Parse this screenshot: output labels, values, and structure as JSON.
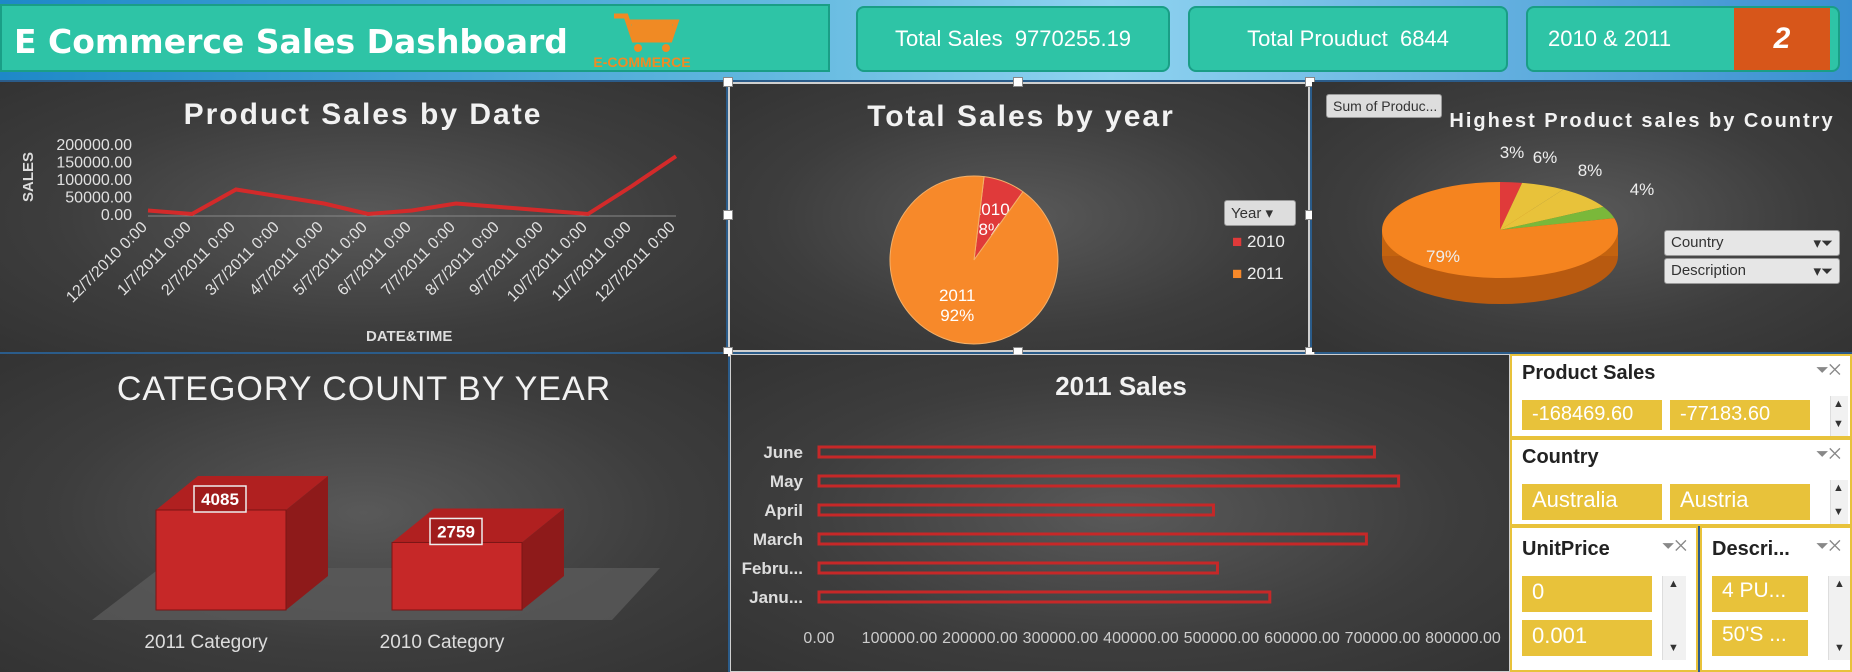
{
  "header": {
    "title": "E Commerce Sales Dashboard",
    "logo_text": "E-COMMERCE",
    "kpis": [
      {
        "label": "Total Sales",
        "value": "9770255.19"
      },
      {
        "label": "Total Prouduct",
        "value": "6844"
      },
      {
        "label": "2010 & 2011",
        "value": ""
      }
    ],
    "year_badge": "2"
  },
  "chart_data": [
    {
      "type": "line",
      "title": "Product Sales by Date",
      "xlabel": "DATE&TIME",
      "ylabel": "SALES",
      "yticks": [
        "200000.00",
        "150000.00",
        "100000.00",
        "50000.00",
        "0.00"
      ],
      "ylim": [
        0,
        200000
      ],
      "categories": [
        "12/7/2010 0:00",
        "1/7/2011 0:00",
        "2/7/2011 0:00",
        "3/7/2011 0:00",
        "4/7/2011 0:00",
        "5/7/2011 0:00",
        "6/7/2011 0:00",
        "7/7/2011 0:00",
        "8/7/2011 0:00",
        "9/7/2011 0:00",
        "10/7/2011 0:00",
        "11/7/2011 0:00",
        "12/7/2011 0:00"
      ],
      "values": [
        10000,
        0,
        70000,
        50000,
        30000,
        0,
        10000,
        30000,
        20000,
        10000,
        0,
        80000,
        165000
      ],
      "color": "#d32a2a"
    },
    {
      "type": "pie",
      "title": "Total Sales by year",
      "legend_title": "Year",
      "slices": [
        {
          "label": "2010",
          "pct": "8%",
          "value": 8,
          "color": "#e03a3a"
        },
        {
          "label": "2011",
          "pct": "92%",
          "value": 92,
          "color": "#f7892a"
        }
      ]
    },
    {
      "type": "pie",
      "title": "Highest Product sales by Country",
      "field_button": "Sum of Produc...",
      "filters": [
        "Country",
        "Description"
      ],
      "slices": [
        {
          "label": "79%",
          "value": 79,
          "color": "#f5841f"
        },
        {
          "label": "3%",
          "value": 3,
          "color": "#e03a3a"
        },
        {
          "label": "6%",
          "value": 6,
          "color": "#e8c23a"
        },
        {
          "label": "8%",
          "value": 8,
          "color": "#e8c23a"
        },
        {
          "label": "4%",
          "value": 4,
          "color": "#7ab83a"
        }
      ]
    },
    {
      "type": "bar",
      "title": "CATEGORY COUNT BY YEAR",
      "categories": [
        "2011 Category",
        "2010  Category"
      ],
      "values": [
        4085,
        2759
      ],
      "color": "#c62828"
    },
    {
      "type": "bar",
      "title": "2011 Sales",
      "categories": [
        "June",
        "May",
        "April",
        "March",
        "Febru...",
        "Janu..."
      ],
      "values": [
        690000,
        720000,
        490000,
        680000,
        495000,
        560000
      ],
      "xticks": [
        "0.00",
        "100000.00",
        "200000.00",
        "300000.00",
        "400000.00",
        "500000.00",
        "600000.00",
        "700000.00",
        "800000.00"
      ],
      "xlim": [
        0,
        800000
      ],
      "color": "#c62828"
    }
  ],
  "slicers": {
    "product_sales": {
      "title": "Product Sales",
      "items": [
        "-168469.60",
        "-77183.60"
      ]
    },
    "country": {
      "title": "Country",
      "items": [
        "Australia",
        "Austria"
      ]
    },
    "unit_price": {
      "title": "UnitPrice",
      "items": [
        "0",
        "0.001"
      ]
    },
    "description": {
      "title": "Descri...",
      "items": [
        "4 PU...",
        "50'S ..."
      ]
    }
  }
}
